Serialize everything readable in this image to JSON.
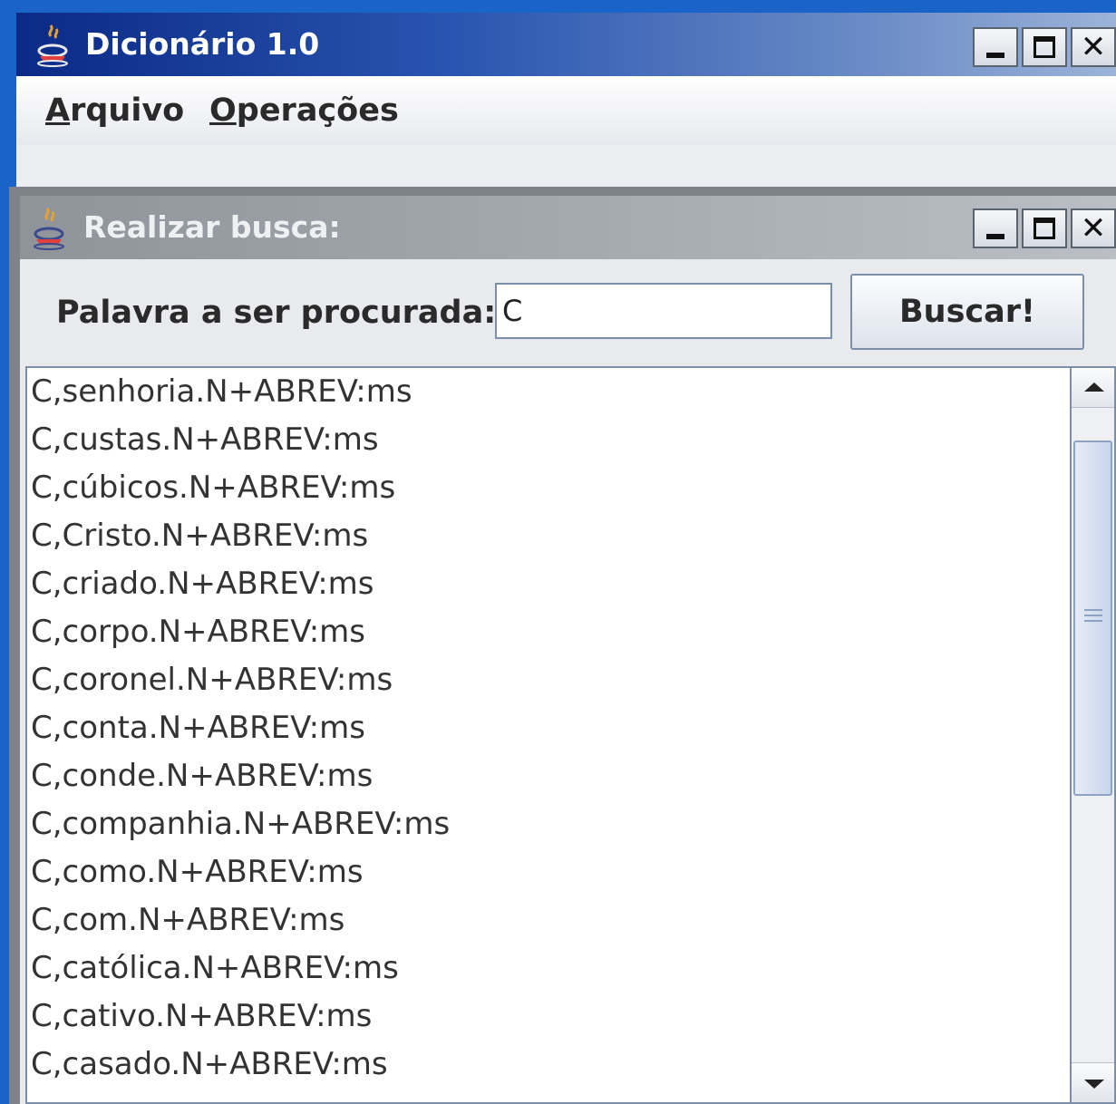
{
  "main_window": {
    "title": "Dicionário 1.0",
    "icon": "java-coffee-cup-icon",
    "menu": [
      {
        "mnemonic": "A",
        "rest": "rquivo"
      },
      {
        "mnemonic": "O",
        "rest": "perações"
      }
    ],
    "buttons": {
      "minimize": "minimize-icon",
      "maximize": "maximize-icon",
      "close": "✕"
    }
  },
  "search_window": {
    "title": "Realizar busca:",
    "icon": "java-coffee-cup-icon",
    "search_label": "Palavra a ser procurada:",
    "search_value": "C",
    "search_button": "Buscar!",
    "buttons": {
      "close": "✕"
    },
    "results": [
      "C,senhoria.N+ABREV:ms",
      "C,custas.N+ABREV:ms",
      "C,cúbicos.N+ABREV:ms",
      "C,Cristo.N+ABREV:ms",
      "C,criado.N+ABREV:ms",
      "C,corpo.N+ABREV:ms",
      "C,coronel.N+ABREV:ms",
      "C,conta.N+ABREV:ms",
      "C,conde.N+ABREV:ms",
      "C,companhia.N+ABREV:ms",
      "C,como.N+ABREV:ms",
      "C,com.N+ABREV:ms",
      "C,católica.N+ABREV:ms",
      "C,cativo.N+ABREV:ms",
      "C,casado.N+ABREV:ms"
    ]
  },
  "colors": {
    "main_titlebar": "#0a2a86",
    "inactive_titlebar": "#a3a9af",
    "accent_border": "#7b8fa8"
  }
}
